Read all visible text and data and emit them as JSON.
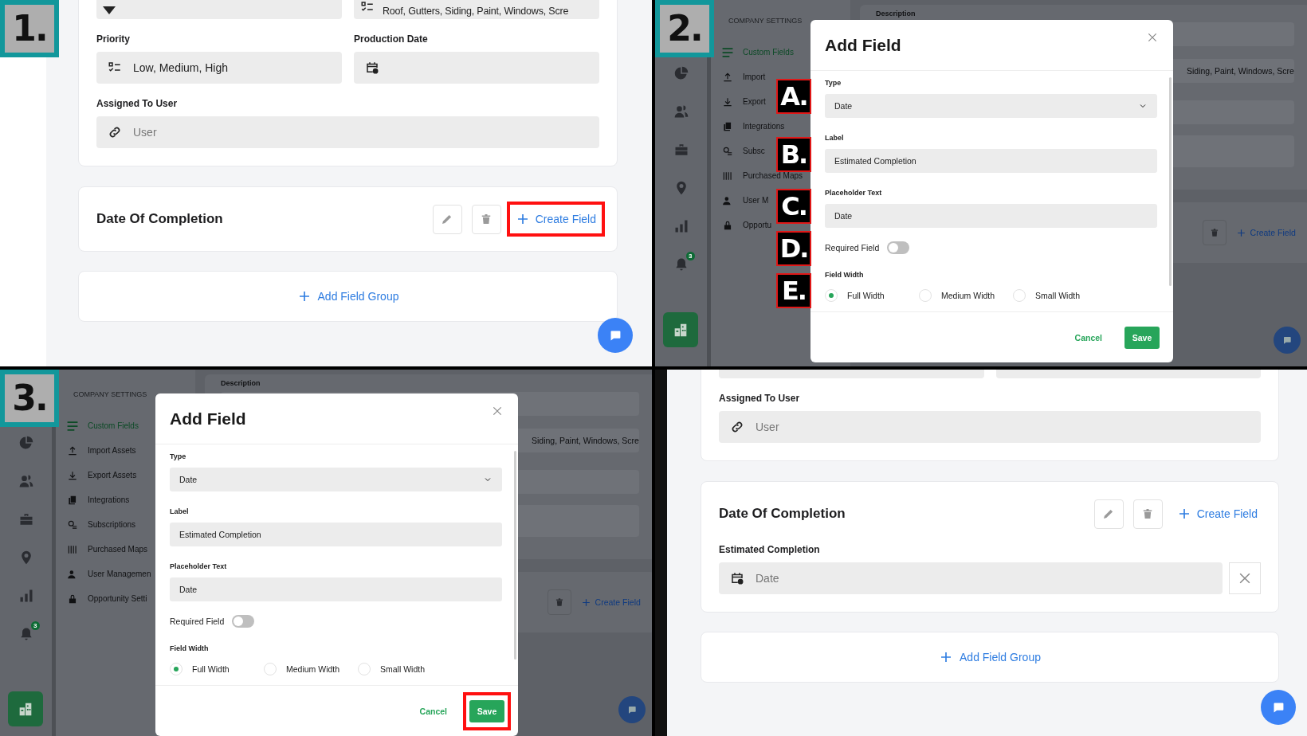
{
  "panels": [
    {
      "kind": "form",
      "step": "1.",
      "top_row": {
        "value": "Roof, Gutters, Siding, Paint, Windows, Scre"
      },
      "fields": [
        {
          "label": "Priority",
          "value": "Low, Medium, High"
        },
        {
          "label": "Production Date"
        }
      ],
      "assigned": {
        "label": "Assigned To User",
        "placeholder": "User"
      },
      "group": {
        "title": "Date Of Completion",
        "create_label": "Create Field",
        "create_highlighted": true
      },
      "add_group": "Add Field Group"
    },
    {
      "kind": "modal",
      "step": "2.",
      "notification_count": "3",
      "settings_heading": "COMPANY SETTINGS",
      "menu": [
        {
          "label": "Custom Fields",
          "selected": true
        },
        {
          "label": "Import",
          "selected": false
        },
        {
          "label": "Export",
          "selected": false
        },
        {
          "label": "Integrations",
          "selected": false
        },
        {
          "label": "Subsc",
          "selected": false
        },
        {
          "label": "Purchased Maps",
          "selected": false
        },
        {
          "label": "User M",
          "selected": false
        },
        {
          "label": "Opportu",
          "selected": false
        }
      ],
      "background": {
        "heading": "Description",
        "value": "Siding, Paint, Windows, Scre",
        "action": "Create Field"
      },
      "dialog": {
        "title": "Add Field",
        "type_label": "Type",
        "type_value": "Date",
        "label_label": "Label",
        "label_value": "Estimated Completion",
        "placeholder_label": "Placeholder Text",
        "placeholder_value": "Date",
        "required_label": "Required Field",
        "required": false,
        "width_label": "Field Width",
        "widths": [
          {
            "label": "Full Width",
            "selected": true
          },
          {
            "label": "Medium Width",
            "selected": false
          },
          {
            "label": "Small Width",
            "selected": false
          }
        ],
        "cancel": "Cancel",
        "save": "Save",
        "save_highlighted": false
      },
      "markers": [
        "A.",
        "B.",
        "C.",
        "D.",
        "E."
      ]
    },
    {
      "kind": "modal",
      "step": "3.",
      "notification_count": "3",
      "settings_heading": "COMPANY SETTINGS",
      "menu": [
        {
          "label": "Custom Fields",
          "selected": true
        },
        {
          "label": "Import Assets",
          "selected": false
        },
        {
          "label": "Export Assets",
          "selected": false
        },
        {
          "label": "Integrations",
          "selected": false
        },
        {
          "label": "Subscriptions",
          "selected": false
        },
        {
          "label": "Purchased Maps",
          "selected": false
        },
        {
          "label": "User Managemen",
          "selected": false
        },
        {
          "label": "Opportunity Setti",
          "selected": false
        }
      ],
      "background": {
        "heading": "Description",
        "value": "Siding, Paint, Windows, Scre",
        "action": "Create Field"
      },
      "dialog": {
        "title": "Add Field",
        "type_label": "Type",
        "type_value": "Date",
        "label_label": "Label",
        "label_value": "Estimated Completion",
        "placeholder_label": "Placeholder Text",
        "placeholder_value": "Date",
        "required_label": "Required Field",
        "required": false,
        "width_label": "Field Width",
        "widths": [
          {
            "label": "Full Width",
            "selected": true
          },
          {
            "label": "Medium Width",
            "selected": false
          },
          {
            "label": "Small Width",
            "selected": false
          }
        ],
        "cancel": "Cancel",
        "save": "Save",
        "save_highlighted": true
      }
    },
    {
      "kind": "form",
      "assigned": {
        "label": "Assigned To User",
        "placeholder": "User"
      },
      "group": {
        "title": "Date Of Completion",
        "create_label": "Create Field",
        "create_highlighted": false,
        "fields": [
          {
            "label": "Estimated Completion",
            "placeholder": "Date"
          }
        ]
      },
      "add_group": "Add Field Group"
    }
  ]
}
